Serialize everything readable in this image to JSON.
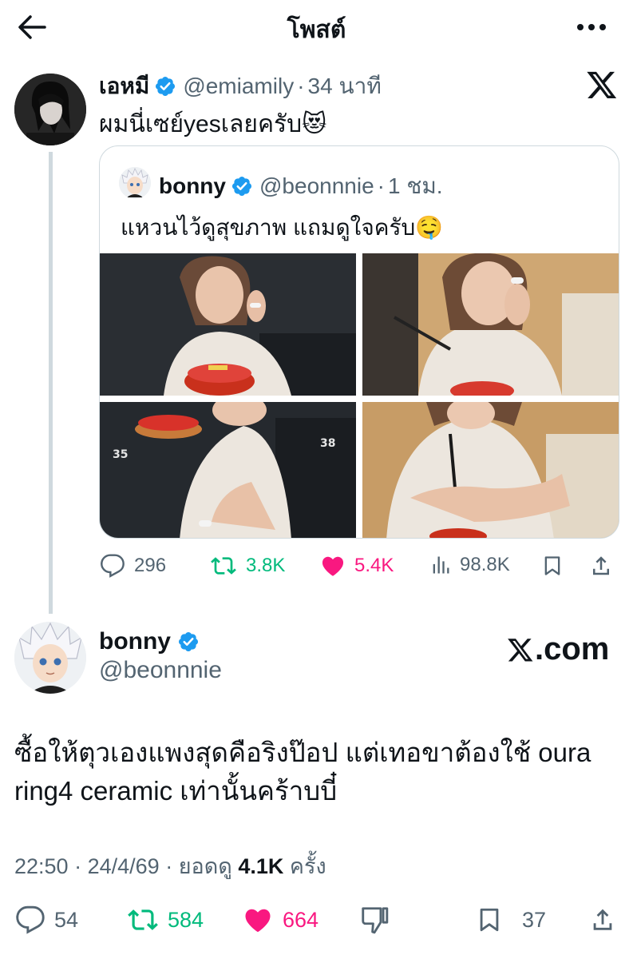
{
  "header": {
    "title": "โพสต์"
  },
  "quote_tweet_author": {
    "name": "เอหมี",
    "handle": "@emiamily",
    "separator": "·",
    "time": "34 นาที",
    "text": "ผมนี่เซย์yesเลยครับ😻"
  },
  "quoted_tweet": {
    "name": "bonny",
    "handle": "@beonnnie",
    "separator": "·",
    "time": "1 ชม.",
    "text": "แหวนไว้ดูสุขภาพ แถมดูใจครับ🤤",
    "stats": {
      "replies": "296",
      "reposts": "3.8K",
      "likes": "5.4K",
      "views": "98.8K"
    }
  },
  "main_tweet": {
    "name": "bonny",
    "handle": "@beonnnie",
    "brand": ".com",
    "text": "ซื้อให้ตุวเองแพงสุดคือริงป๊อป แต่เทอขาต้องใช้ oura ring4 ceramic เท่านั้นคร้าบบี๋",
    "time": "22:50",
    "date": "24/4/69",
    "views_label": "ยอดดู",
    "views_count": "4.1K",
    "views_suffix": "ครั้ง",
    "separator": "·",
    "stats": {
      "replies": "54",
      "reposts": "584",
      "likes": "664",
      "bookmarks": "37"
    }
  },
  "colors": {
    "text": "#0f1419",
    "muted": "#536471",
    "repost": "#00ba7c",
    "like": "#f91880",
    "verified": "#1d9bf0",
    "border": "#cfd9de"
  }
}
